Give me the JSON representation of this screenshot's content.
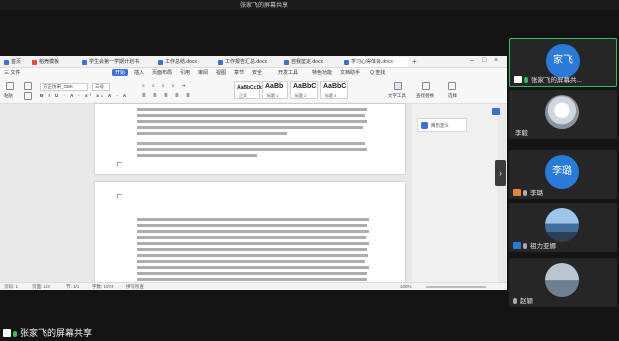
{
  "meeting": {
    "title": "张家飞的屏幕共享"
  },
  "wps": {
    "tabs": [
      {
        "label": "首页",
        "color": "#3b6fd9"
      },
      {
        "label": "稻壳模板",
        "color": "#e94b3c"
      },
      {
        "label": "学生会第一学期计划书",
        "color": "#3b6fd9"
      },
      {
        "label": "工作总结.docx",
        "color": "#3b6fd9"
      },
      {
        "label": "工作报告汇总.docx",
        "color": "#3b6fd9"
      },
      {
        "label": "自我鉴定.docx",
        "color": "#3b6fd9"
      },
      {
        "label": "学习心得体会.docx",
        "color": "#3b6fd9"
      }
    ],
    "menu": [
      "三 文件",
      "开始",
      "插入",
      "页面布局",
      "引用",
      "审阅",
      "视图",
      "章节",
      "安全",
      "开发工具",
      "特色功能",
      "文档助手",
      "Q 查找"
    ],
    "active_menu_index": 1,
    "ribbon": {
      "paste": "粘贴",
      "font": "方正仿宋_GBK",
      "size": "三号",
      "styles": [
        {
          "big": "AaBbCcDd",
          "small": "正文"
        },
        {
          "big": "AaBb",
          "small": "标题 1"
        },
        {
          "big": "AaBbC",
          "small": "标题 2"
        },
        {
          "big": "AaBbC",
          "small": "标题 3"
        }
      ],
      "text_tools": "文字工具",
      "find_replace": "查找替换",
      "select": "选择"
    },
    "comment": {
      "label": "简历定义"
    },
    "status": {
      "page": "页码: 1",
      "pages": "页面: 1/3",
      "section": "节: 1/1",
      "words": "字数: 1074",
      "spell": "拼写检查",
      "zoom": "100%"
    }
  },
  "participants": [
    {
      "name": "张家飞的屏幕共...",
      "avatar_text": "家飞",
      "avatar_color": "#2a7ad8",
      "mic": "on",
      "badge_color": "#ffffff",
      "active": true
    },
    {
      "name": "李毅",
      "avatar_text": "",
      "avatar_color": "#cfd6de",
      "mic": "none",
      "badge_color": "",
      "active": false
    },
    {
      "name": "李璐",
      "avatar_text": "李璐",
      "avatar_color": "#2a7ad8",
      "mic": "muted",
      "badge_color": "#e8853a",
      "active": false
    },
    {
      "name": "祖力亚娜",
      "avatar_text": "",
      "avatar_color": "#5a8fc4",
      "mic": "muted",
      "badge_color": "#2a7ad8",
      "active": false
    },
    {
      "name": "赵颖",
      "avatar_text": "",
      "avatar_color": "#7a8b98",
      "mic": "muted",
      "badge_color": "",
      "active": false
    }
  ],
  "share_label": "张家飞的屏幕共享"
}
